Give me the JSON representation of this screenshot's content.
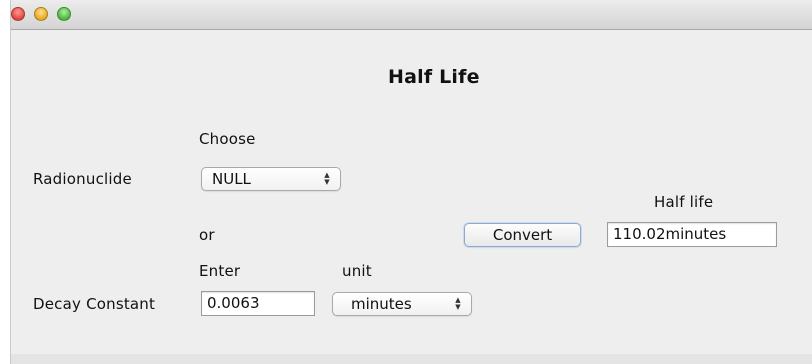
{
  "window": {
    "controls": [
      "close",
      "minimize",
      "zoom"
    ]
  },
  "main": {
    "title": "Half Life",
    "choose_label": "Choose",
    "radionuclide_label": "Radionuclide",
    "radionuclide_select": {
      "value": "NULL"
    },
    "or_label": "or",
    "enter_label": "Enter",
    "unit_label": "unit",
    "decay_constant_label": "Decay Constant",
    "decay_constant_value": "0.0063",
    "unit_select": {
      "value": "minutes"
    },
    "convert_button": "Convert",
    "half_life_label": "Half life",
    "half_life_value": "110.02minutes"
  }
}
